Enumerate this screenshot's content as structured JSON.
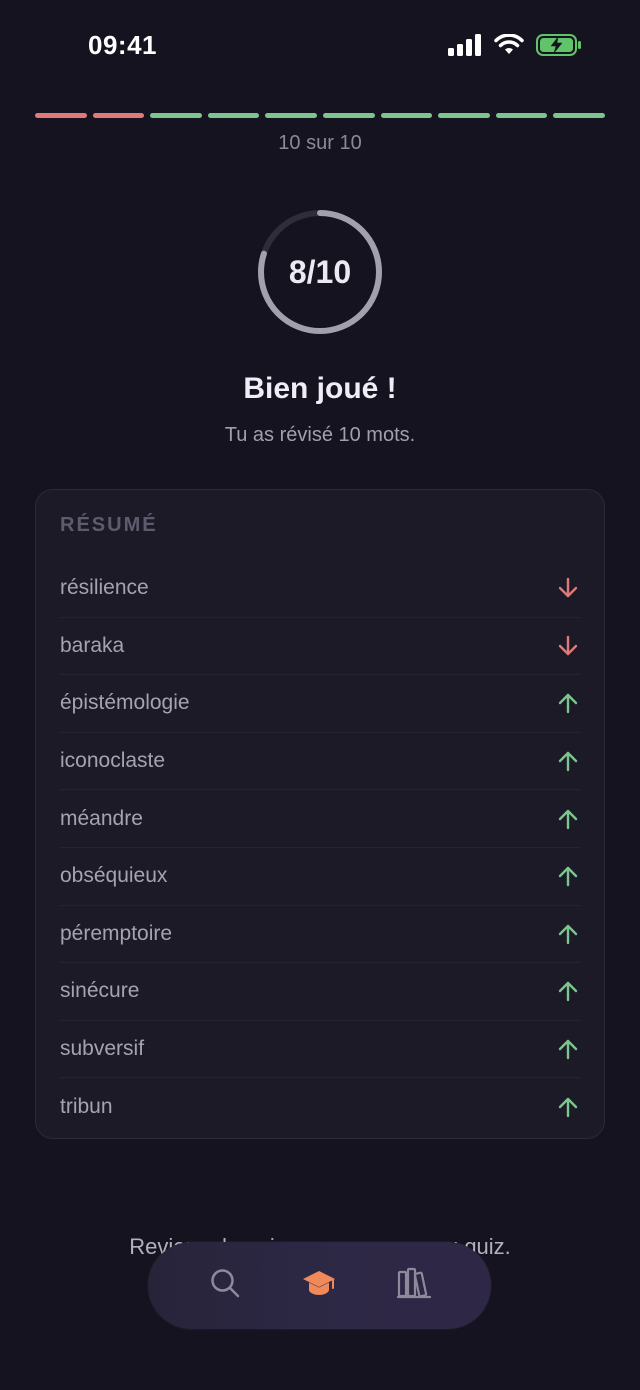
{
  "status_bar": {
    "time": "09:41",
    "icons": [
      "signal-icon",
      "wifi-icon",
      "battery-charging-icon"
    ]
  },
  "quiz_progress": {
    "label": "10 sur 10",
    "answered": 10,
    "total": 10,
    "segments": [
      "wrong",
      "wrong",
      "right",
      "right",
      "right",
      "right",
      "right",
      "right",
      "right",
      "right"
    ]
  },
  "score": {
    "text": "8/10",
    "correct": 8,
    "total": 10
  },
  "result": {
    "headline": "Bien joué !",
    "subline": "Tu as révisé 10 mots."
  },
  "summary": {
    "heading": "RÉSUMÉ",
    "items": [
      {
        "word": "résilience",
        "trend": "down"
      },
      {
        "word": "baraka",
        "trend": "down"
      },
      {
        "word": "épistémologie",
        "trend": "up"
      },
      {
        "word": "iconoclaste",
        "trend": "up"
      },
      {
        "word": "méandre",
        "trend": "up"
      },
      {
        "word": "obséquieux",
        "trend": "up"
      },
      {
        "word": "péremptoire",
        "trend": "up"
      },
      {
        "word": "sinécure",
        "trend": "up"
      },
      {
        "word": "subversif",
        "trend": "up"
      },
      {
        "word": "tribun",
        "trend": "up"
      }
    ]
  },
  "footer": {
    "text": "Reviens demain pour un nouveau quiz."
  },
  "nav": {
    "items": [
      {
        "name": "search",
        "icon": "search-icon",
        "active": false
      },
      {
        "name": "learn",
        "icon": "graduation-cap-icon",
        "active": true
      },
      {
        "name": "library",
        "icon": "books-icon",
        "active": false
      }
    ]
  },
  "colors": {
    "background": "#15131f",
    "wrong": "#e07a78",
    "right": "#7cc58e",
    "accent": "#f08a5a",
    "muted_icon": "#8e8a9c"
  }
}
